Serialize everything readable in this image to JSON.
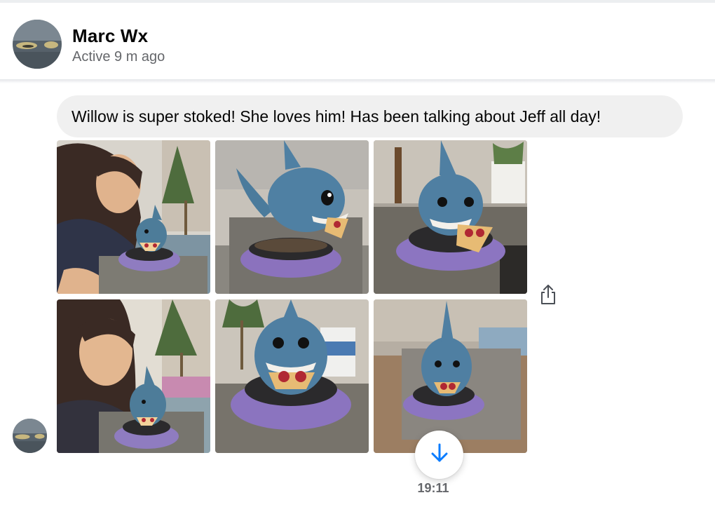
{
  "header": {
    "contact_name": "Marc Wx",
    "status": "Active 9 m ago"
  },
  "conversation": {
    "message_text": "Willow is super stoked! She loves him! Has been talking about Jeff all day!",
    "photo_count": 6,
    "timestamp": "19:11"
  },
  "icons": {
    "share": "share-icon",
    "scroll_down": "arrow-down-icon"
  },
  "colors": {
    "accent": "#0a7cff",
    "bubble": "#f0f0f0",
    "secondary_text": "#65676b"
  }
}
